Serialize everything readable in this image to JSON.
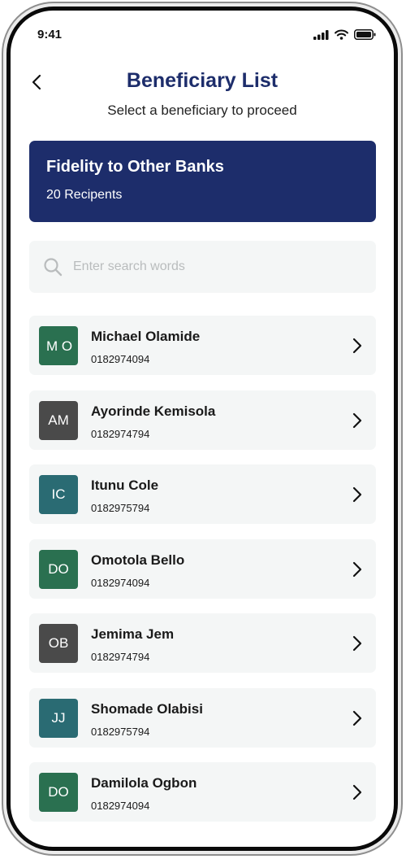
{
  "status_bar": {
    "time": "9:41"
  },
  "header": {
    "title": "Beneficiary List",
    "subtitle": "Select a beneficiary to proceed"
  },
  "bank_card": {
    "title": "Fidelity to Other Banks",
    "count": "20 Recipents"
  },
  "search": {
    "placeholder": "Enter search words",
    "value": ""
  },
  "beneficiaries": [
    {
      "initials": "M O",
      "name": "Michael Olamide",
      "account": "0182974094",
      "color": "#2a7050"
    },
    {
      "initials": "AM",
      "name": "Ayorinde Kemisola",
      "account": "0182974794",
      "color": "#4a4a4a"
    },
    {
      "initials": "IC",
      "name": "Itunu Cole",
      "account": "0182975794",
      "color": "#2a6b73"
    },
    {
      "initials": "DO",
      "name": "Omotola Bello",
      "account": "0182974094",
      "color": "#2a7050"
    },
    {
      "initials": "OB",
      "name": "Jemima Jem",
      "account": "0182974794",
      "color": "#4a4a4a"
    },
    {
      "initials": "JJ",
      "name": "Shomade Olabisi",
      "account": "0182975794",
      "color": "#2a6b73"
    },
    {
      "initials": "DO",
      "name": "Damilola Ogbon",
      "account": "0182974094",
      "color": "#2a7050"
    }
  ],
  "colors": {
    "brand_navy": "#1d2d6b",
    "list_bg": "#f4f6f6"
  },
  "icons": {
    "back": "chevron-left-icon",
    "search": "search-icon",
    "row_action": "chevron-right-icon",
    "signal": "signal-icon",
    "wifi": "wifi-icon",
    "battery": "battery-icon"
  }
}
